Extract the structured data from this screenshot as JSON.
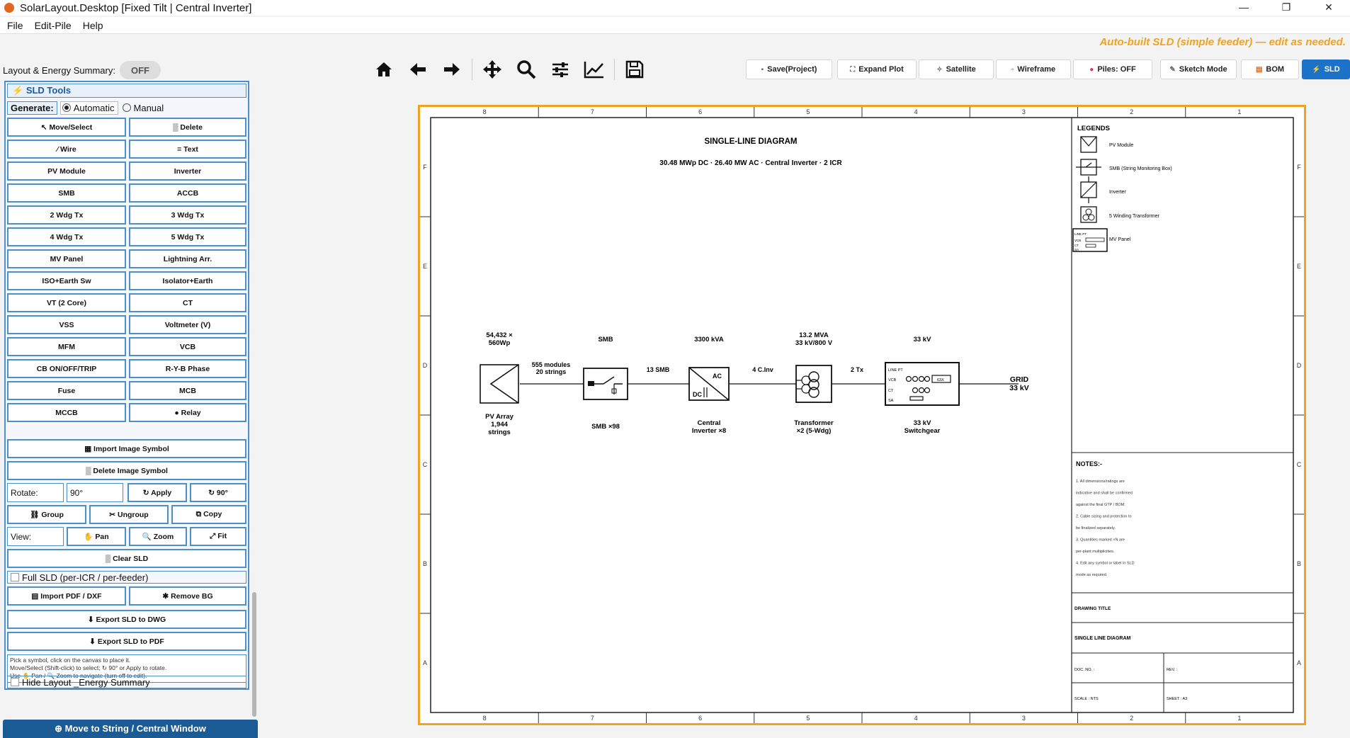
{
  "window": {
    "title": "SolarLayout.Desktop  [Fixed Tilt  |  Central Inverter]",
    "minimize": "—",
    "maximize": "❐",
    "close": "✕"
  },
  "menu": [
    "File",
    "Edit-Pile",
    "Help"
  ],
  "banner": "Auto-built SLD (simple feeder) — edit as needed.",
  "summary": {
    "label": "Layout & Energy Summary:",
    "toggle": "OFF"
  },
  "tools": {
    "header": "SLD Tools",
    "header_icon": "⚡",
    "generate": "Generate:",
    "mode_auto": "Automatic",
    "mode_manual": "Manual",
    "buttons": [
      [
        "↖ Move/Select",
        "▒ Delete"
      ],
      [
        "∕ Wire",
        "≡ Text"
      ],
      [
        "PV Module",
        "Inverter"
      ],
      [
        "SMB",
        "ACCB"
      ],
      [
        "2 Wdg Tx",
        "3 Wdg Tx"
      ],
      [
        "4 Wdg Tx",
        "5 Wdg Tx"
      ],
      [
        "MV Panel",
        "Lightning Arr."
      ],
      [
        "ISO+Earth Sw",
        "Isolator+Earth"
      ],
      [
        "VT (2 Core)",
        "CT"
      ],
      [
        "VSS",
        "Voltmeter (V)"
      ],
      [
        "MFM",
        "VCB"
      ],
      [
        "CB ON/OFF/TRIP",
        "R-Y-B Phase"
      ],
      [
        "Fuse",
        "MCB"
      ],
      [
        "MCCB",
        "● Relay"
      ]
    ],
    "import_image": "▦ Import Image Symbol",
    "delete_image": "▒ Delete Image Symbol",
    "rotate_label": "Rotate:",
    "rotate_value": "90°",
    "apply": "↻ Apply",
    "rot90": "↻ 90°",
    "group": "⛓ Group",
    "ungroup": "✂ Ungroup",
    "copy": "⧉ Copy",
    "view_label": "View:",
    "pan": "✋ Pan",
    "zoom": "🔍 Zoom",
    "fit": "⤢ Fit",
    "clear": "▒ Clear SLD",
    "full_sld": "Full SLD (per-ICR / per-feeder)",
    "import_pdf": "▤ Import PDF / DXF",
    "remove_bg": "✱ Remove BG",
    "export_dwg": "⬇ Export SLD to DWG",
    "export_pdf": "⬇ Export SLD to PDF",
    "help": [
      "Pick a symbol, click on the canvas to place it.",
      "Move/Select (Shift-click) to select; ↻ 90° or Apply to rotate.",
      "Use ✋ Pan / 🔍 Zoom to navigate (turn off to edit)."
    ],
    "hide_summary": "Hide Layout _Energy Summary"
  },
  "bottom_button": "⊕ Move to String / Central Window",
  "toolbar_right": [
    "Save(Project)",
    "Expand Plot",
    "Satellite",
    "Wireframe",
    "Piles: OFF",
    "Sketch Mode",
    "BOM",
    "SLD"
  ],
  "toolbar_icons": [
    "home-icon",
    "arrow-left-icon",
    "arrow-right-icon",
    "move-icon",
    "search-icon",
    "sliders-icon",
    "chart-line-icon",
    "save-icon"
  ],
  "sld": {
    "title": "SINGLE-LINE DIAGRAM",
    "subtitle": "30.48 MWp DC · 26.40 MW AC · Central Inverter · 2 ICR",
    "col_labels": [
      "8",
      "7",
      "6",
      "5",
      "4",
      "3",
      "2",
      "1"
    ],
    "row_labels": [
      "F",
      "E",
      "D",
      "C",
      "B",
      "A"
    ],
    "top": {
      "pv": "54,432 ×\n560Wp",
      "smb": "SMB",
      "inv": "3300 kVA",
      "tx": "13.2 MVA\n33 kV/800 V",
      "swg": "33 kV"
    },
    "links": {
      "l1": "555 modules\n20 strings",
      "l2": "13 SMB",
      "l3": "4 C.Inv",
      "l4": "2 Tx"
    },
    "bottom": {
      "pv": "PV Array\n1,944\nstrings",
      "smb": "SMB ×98",
      "inv": "Central\nInverter ×8",
      "tx": "Transformer\n×2 (5-Wdg)",
      "swg": "33 kV\nSwitchgear"
    },
    "grid": "GRID\n33 kV",
    "inv_ac": "AC",
    "inv_dc": "DC",
    "panel_text": {
      "line_pt": "LINE PT",
      "vcb": "VCB",
      "ct": "CT",
      "sa": "SA",
      "x63": "63X"
    },
    "legends_title": "LEGENDS",
    "legends": [
      "PV Module",
      "SMB (String Monitoring Box)",
      "Inverter",
      "5 Winding Transformer",
      "MV Panel"
    ],
    "notes_title": "NOTES:-",
    "notes": [
      "1. All dimensions/ratings are",
      "indicative and shall be confirmed",
      "against the final GTP / BOM.",
      "2. Cable sizing and protection to",
      "be finalized separately.",
      "3. Quantities marked ×N are",
      "per-plant multiplicities.",
      "4. Edit any symbol or label in SLD",
      "mode as required."
    ],
    "drawing_title_label": "DRAWING TITLE",
    "drawing_title": "SINGLE LINE DIAGRAM",
    "doc_no": "DOC. NO. :",
    "rev": "REV. :",
    "scale": "SCALE : NTS",
    "sheet": "SHEET : A3"
  }
}
